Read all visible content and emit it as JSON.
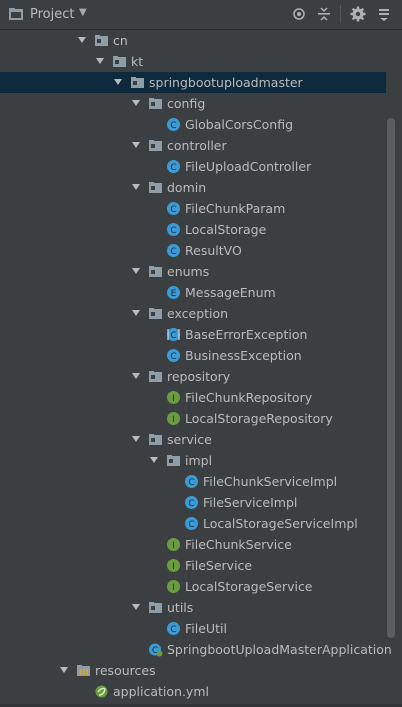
{
  "header": {
    "title": "Project",
    "dropdown_icon": "triangle-down-icon",
    "buttons": [
      "locate-icon",
      "collapse-all-icon",
      "gear-icon",
      "hide-icon"
    ]
  },
  "colors": {
    "background": "#3c3f41",
    "selection": "#0d293e",
    "class_icon": "#3a9bd6",
    "interface_icon": "#6a9c3f",
    "enum_icon": "#3a9bd6"
  },
  "tree": [
    {
      "label": "cn",
      "kind": "package",
      "expanded": true,
      "depth": 0
    },
    {
      "label": "kt",
      "kind": "package",
      "expanded": true,
      "depth": 1
    },
    {
      "label": "springbootuploadmaster",
      "kind": "package",
      "expanded": true,
      "depth": 2,
      "selected": true
    },
    {
      "label": "config",
      "kind": "package",
      "expanded": true,
      "depth": 3
    },
    {
      "label": "GlobalCorsConfig",
      "kind": "class",
      "depth": 4
    },
    {
      "label": "controller",
      "kind": "package",
      "expanded": true,
      "depth": 3
    },
    {
      "label": "FileUploadController",
      "kind": "class",
      "depth": 4
    },
    {
      "label": "domin",
      "kind": "package",
      "expanded": true,
      "depth": 3
    },
    {
      "label": "FileChunkParam",
      "kind": "class",
      "depth": 4
    },
    {
      "label": "LocalStorage",
      "kind": "class",
      "depth": 4
    },
    {
      "label": "ResultVO",
      "kind": "class",
      "depth": 4
    },
    {
      "label": "enums",
      "kind": "package",
      "expanded": true,
      "depth": 3
    },
    {
      "label": "MessageEnum",
      "kind": "enum",
      "depth": 4
    },
    {
      "label": "exception",
      "kind": "package",
      "expanded": true,
      "depth": 3
    },
    {
      "label": "BaseErrorException",
      "kind": "abstract",
      "depth": 4
    },
    {
      "label": "BusinessException",
      "kind": "class",
      "depth": 4
    },
    {
      "label": "repository",
      "kind": "package",
      "expanded": true,
      "depth": 3
    },
    {
      "label": "FileChunkRepository",
      "kind": "interface",
      "depth": 4
    },
    {
      "label": "LocalStorageRepository",
      "kind": "interface",
      "depth": 4
    },
    {
      "label": "service",
      "kind": "package",
      "expanded": true,
      "depth": 3
    },
    {
      "label": "impl",
      "kind": "package",
      "expanded": true,
      "depth": 4
    },
    {
      "label": "FileChunkServiceImpl",
      "kind": "class",
      "depth": 5
    },
    {
      "label": "FileServiceImpl",
      "kind": "class",
      "depth": 5
    },
    {
      "label": "LocalStorageServiceImpl",
      "kind": "class",
      "depth": 5
    },
    {
      "label": "FileChunkService",
      "kind": "interface",
      "depth": 4
    },
    {
      "label": "FileService",
      "kind": "interface",
      "depth": 4
    },
    {
      "label": "LocalStorageService",
      "kind": "interface",
      "depth": 4
    },
    {
      "label": "utils",
      "kind": "package",
      "expanded": true,
      "depth": 3
    },
    {
      "label": "FileUtil",
      "kind": "class",
      "depth": 4
    },
    {
      "label": "SpringbootUploadMasterApplication",
      "kind": "spring-app",
      "depth": 3
    },
    {
      "label": "resources",
      "kind": "resources-folder",
      "expanded": true,
      "depth": -1
    },
    {
      "label": "application.yml",
      "kind": "yml",
      "depth": 0
    }
  ]
}
